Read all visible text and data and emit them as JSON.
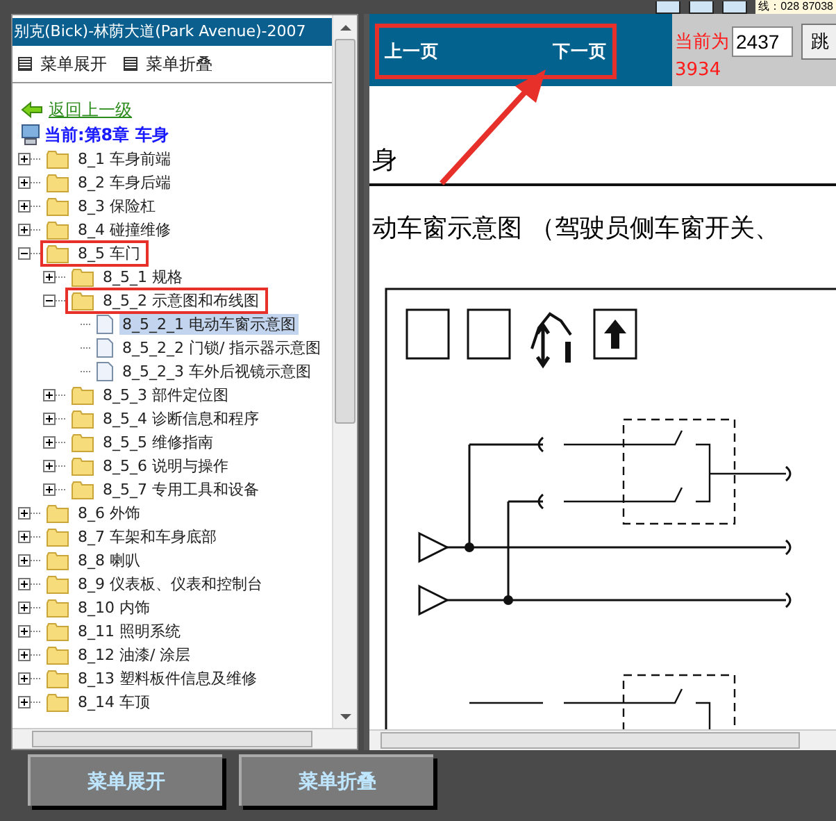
{
  "top_strip": {
    "text": "线：028 87038"
  },
  "sidebar": {
    "title": "别克(Bick)-林荫大道(Park Avenue)-2007",
    "menu": [
      "菜单展开",
      "菜单折叠"
    ],
    "back_link": "返回上一级",
    "current": "当前:第8章 车身",
    "tree": [
      {
        "label": "8_1 车身前端",
        "kind": "folder",
        "expanded": false,
        "selected": false,
        "annotated": false
      },
      {
        "label": "8_2 车身后端",
        "kind": "folder",
        "expanded": false,
        "selected": false,
        "annotated": false
      },
      {
        "label": "8_3 保险杠",
        "kind": "folder",
        "expanded": false,
        "selected": false,
        "annotated": false
      },
      {
        "label": "8_4 碰撞维修",
        "kind": "folder",
        "expanded": false,
        "selected": false,
        "annotated": false
      },
      {
        "label": "8_5 车门",
        "kind": "folder",
        "expanded": true,
        "selected": false,
        "annotated": true,
        "children": [
          {
            "label": "8_5_1 规格",
            "kind": "folder",
            "expanded": false,
            "selected": false,
            "annotated": false
          },
          {
            "label": "8_5_2 示意图和布线图",
            "kind": "folder",
            "expanded": true,
            "selected": false,
            "annotated": true,
            "children": [
              {
                "label": "8_5_2_1 电动车窗示意图",
                "kind": "document",
                "selected": true,
                "annotated": false
              },
              {
                "label": "8_5_2_2 门锁/ 指示器示意图",
                "kind": "document",
                "selected": false,
                "annotated": false
              },
              {
                "label": "8_5_2_3 车外后视镜示意图",
                "kind": "document",
                "selected": false,
                "annotated": false
              }
            ]
          },
          {
            "label": "8_5_3 部件定位图",
            "kind": "folder",
            "expanded": false,
            "selected": false,
            "annotated": false
          },
          {
            "label": "8_5_4 诊断信息和程序",
            "kind": "folder",
            "expanded": false,
            "selected": false,
            "annotated": false
          },
          {
            "label": "8_5_5 维修指南",
            "kind": "folder",
            "expanded": false,
            "selected": false,
            "annotated": false
          },
          {
            "label": "8_5_6 说明与操作",
            "kind": "folder",
            "expanded": false,
            "selected": false,
            "annotated": false
          },
          {
            "label": "8_5_7 专用工具和设备",
            "kind": "folder",
            "expanded": false,
            "selected": false,
            "annotated": false
          }
        ]
      },
      {
        "label": "8_6 外饰",
        "kind": "folder",
        "expanded": false,
        "selected": false,
        "annotated": false
      },
      {
        "label": "8_7 车架和车身底部",
        "kind": "folder",
        "expanded": false,
        "selected": false,
        "annotated": false
      },
      {
        "label": "8_8 喇叭",
        "kind": "folder",
        "expanded": false,
        "selected": false,
        "annotated": false
      },
      {
        "label": "8_9 仪表板、仪表和控制台",
        "kind": "folder",
        "expanded": false,
        "selected": false,
        "annotated": false
      },
      {
        "label": "8_10 内饰",
        "kind": "folder",
        "expanded": false,
        "selected": false,
        "annotated": false
      },
      {
        "label": "8_11 照明系统",
        "kind": "folder",
        "expanded": false,
        "selected": false,
        "annotated": false
      },
      {
        "label": "8_12 油漆/ 涂层",
        "kind": "folder",
        "expanded": false,
        "selected": false,
        "annotated": false
      },
      {
        "label": "8_13 塑料板件信息及维修",
        "kind": "folder",
        "expanded": false,
        "selected": false,
        "annotated": false
      },
      {
        "label": "8_14 车顶",
        "kind": "folder",
        "expanded": false,
        "selected": false,
        "annotated": false
      }
    ]
  },
  "viewer": {
    "prev": "上一页",
    "next": "下一页",
    "nav_annotated": true,
    "current_label": "当前为",
    "page_value": "2437",
    "jump_button": "跳",
    "total": "3934",
    "heading": "身",
    "subtitle": "动车窗示意图 （驾驶员侧车窗开关、"
  },
  "bottom_buttons": [
    "菜单展开",
    "菜单折叠"
  ]
}
